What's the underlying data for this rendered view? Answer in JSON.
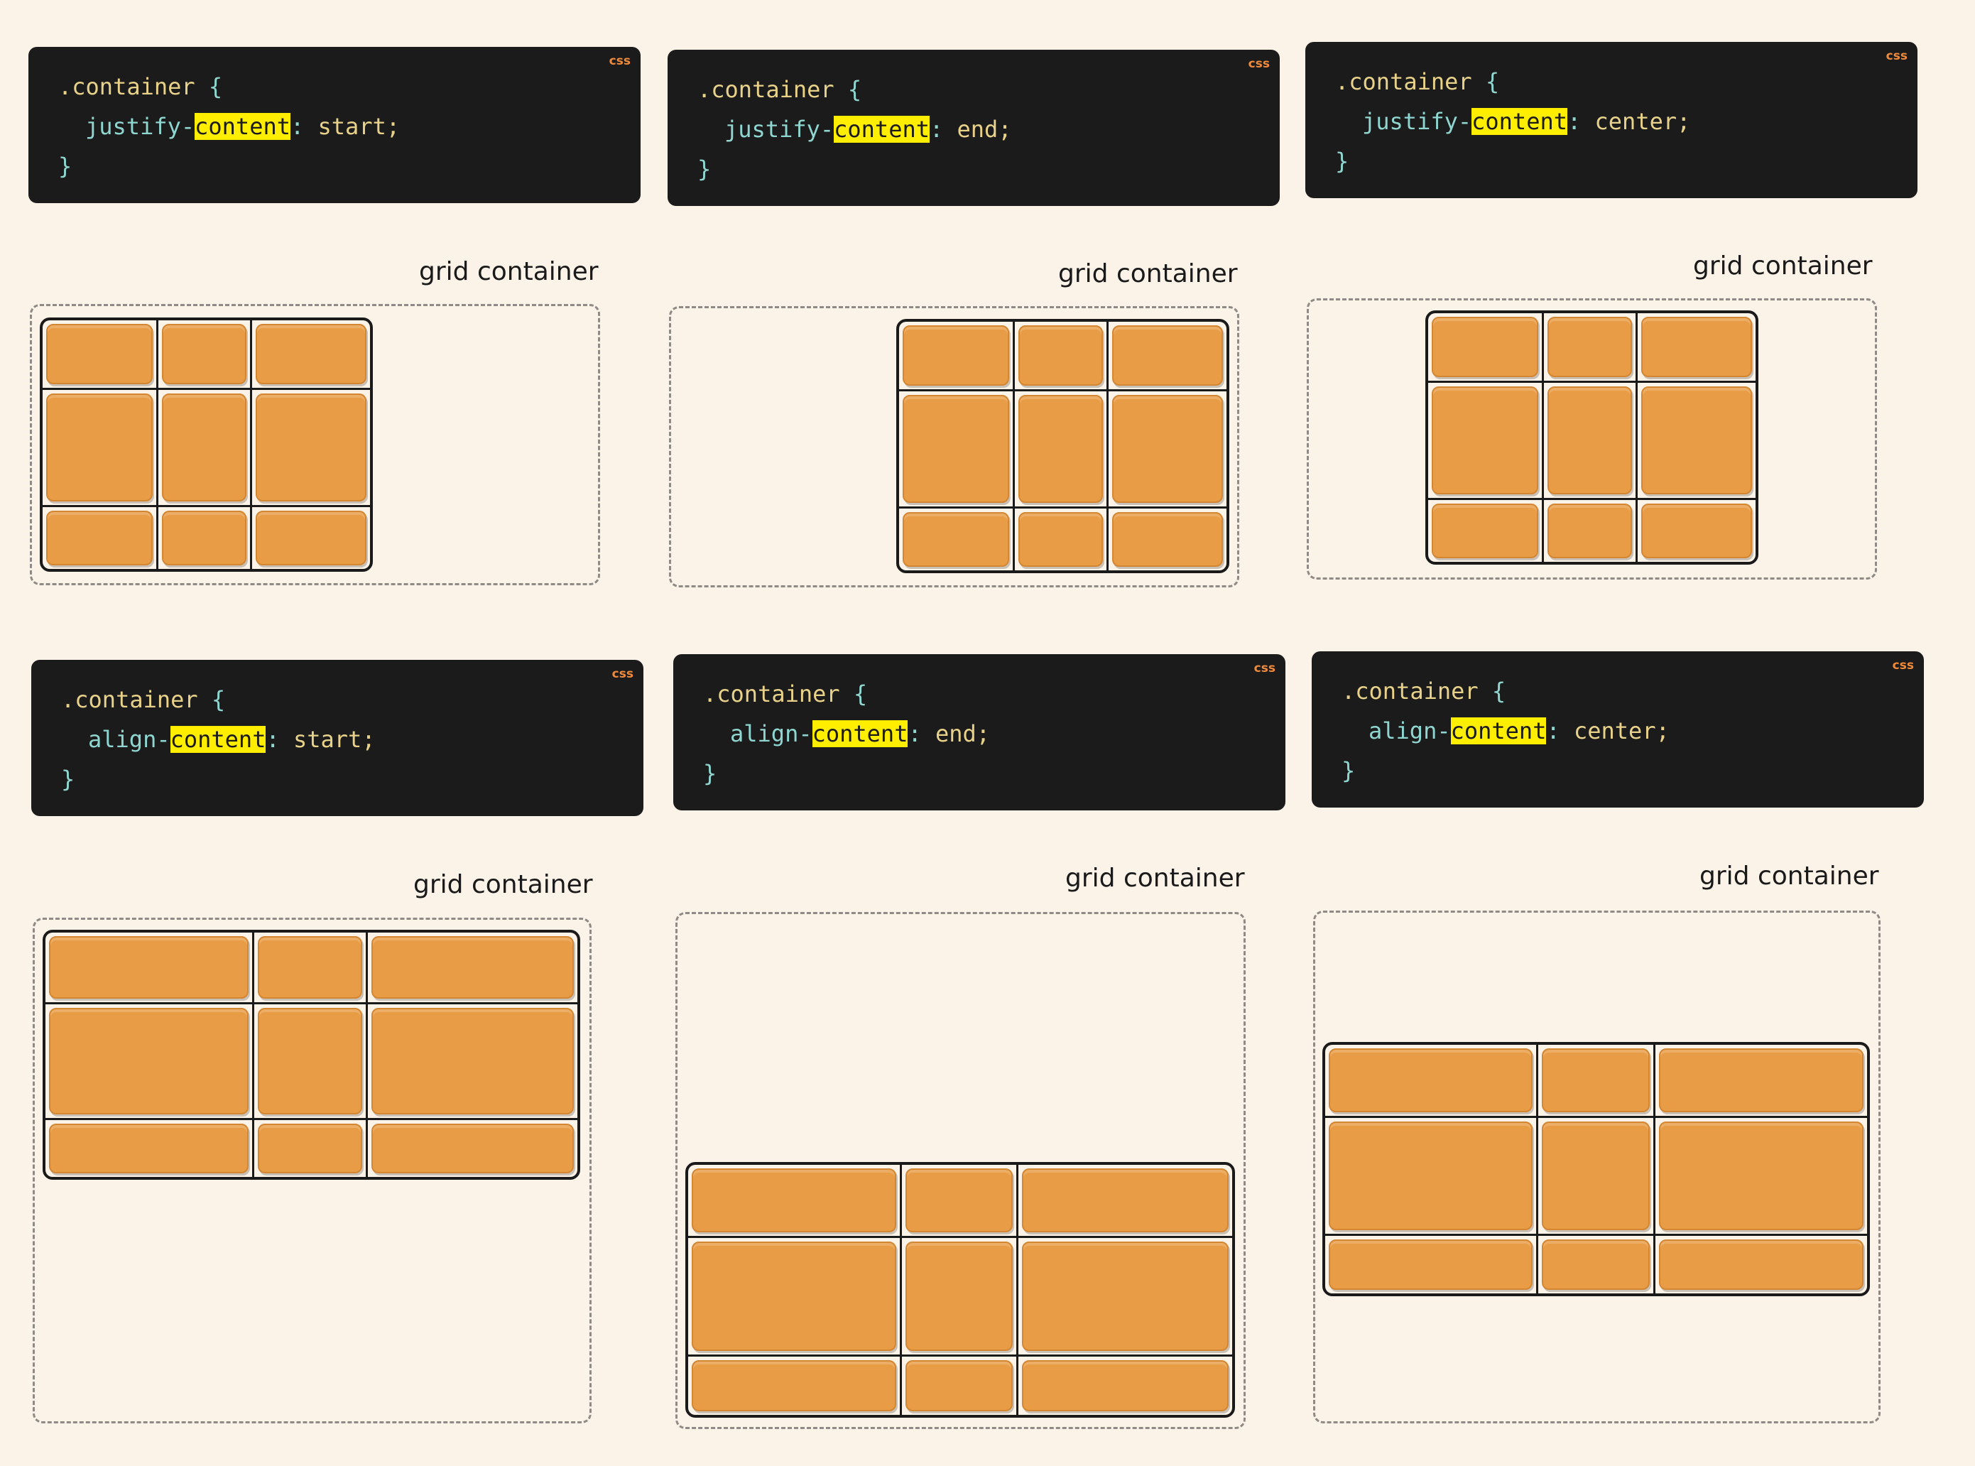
{
  "selector": ".container",
  "open_brace": "{",
  "close_brace": "}",
  "lang_badge": "css",
  "grid_label": "grid container",
  "panels": [
    {
      "prop_before": "justify-",
      "prop_highlight": "content",
      "separator": ": ",
      "value": "start;"
    },
    {
      "prop_before": "justify-",
      "prop_highlight": "content",
      "separator": ": ",
      "value": "end;"
    },
    {
      "prop_before": "justify-",
      "prop_highlight": "content",
      "separator": ": ",
      "value": "center;"
    },
    {
      "prop_before": "align-",
      "prop_highlight": "content",
      "separator": ": ",
      "value": "start;"
    },
    {
      "prop_before": "align-",
      "prop_highlight": "content",
      "separator": ": ",
      "value": "end;"
    },
    {
      "prop_before": "align-",
      "prop_highlight": "content",
      "separator": ": ",
      "value": "center;"
    }
  ],
  "colors": {
    "background": "#fcf3e8",
    "code_bg": "#1b1b1b",
    "highlight": "#ffee00",
    "item": "#e89c45",
    "lang_badge": "#f08a3a"
  }
}
